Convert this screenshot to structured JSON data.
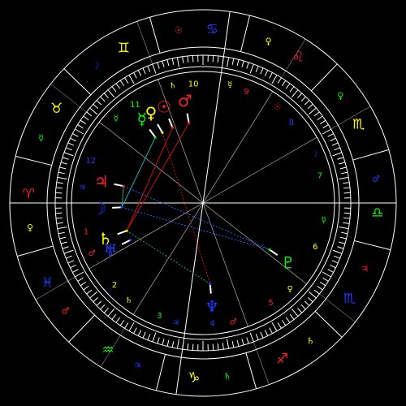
{
  "colors": {
    "background": "#000000",
    "ring_lines": "#ffffff",
    "house_lines": "#cccccc",
    "fire": "#ff2020",
    "earth": "#ffff00",
    "air": "#00ff00",
    "water": "#1a3cff",
    "aspect_red": "#cc1111",
    "aspect_blue": "#2266ff",
    "aspect_green": "#22aa66",
    "aspect_cyan": "#22aaaa"
  },
  "zodiac_signs": [
    {
      "glyph": "♏",
      "color": "#ffff00",
      "name": "virgo"
    },
    {
      "glyph": "♌",
      "color": "#ff2020",
      "name": "leo"
    },
    {
      "glyph": "♋",
      "color": "#1a3cff",
      "name": "cancer"
    },
    {
      "glyph": "♊",
      "color": "#ffff00",
      "name": "gemini"
    },
    {
      "glyph": "♉",
      "color": "#ffff00",
      "name": "taurus"
    },
    {
      "glyph": "♈",
      "color": "#ff2020",
      "name": "aries"
    },
    {
      "glyph": "♓",
      "color": "#1a3cff",
      "name": "pisces"
    },
    {
      "glyph": "♒",
      "color": "#00ff00",
      "name": "aquarius"
    },
    {
      "glyph": "♑",
      "color": "#ffff00",
      "name": "capricorn"
    },
    {
      "glyph": "♐",
      "color": "#ff2020",
      "name": "sagittarius"
    },
    {
      "glyph": "♏",
      "color": "#1a3cff",
      "name": "scorpio"
    },
    {
      "glyph": "♎",
      "color": "#00ff00",
      "name": "libra"
    }
  ],
  "sign_rulers": [
    {
      "glyph": "♀",
      "color": "#00ff00"
    },
    {
      "glyph": "♀",
      "color": "#ffff00"
    },
    {
      "glyph": "☉",
      "color": "#ff2020"
    },
    {
      "glyph": "☽",
      "color": "#1a3cff"
    },
    {
      "glyph": "☿",
      "color": "#00ff00"
    },
    {
      "glyph": "♀",
      "color": "#ffff00"
    },
    {
      "glyph": "♂",
      "color": "#ff2020"
    },
    {
      "glyph": "♃",
      "color": "#1a3cff"
    },
    {
      "glyph": "♄",
      "color": "#00ff00"
    },
    {
      "glyph": "♄",
      "color": "#ffff00"
    },
    {
      "glyph": "♃",
      "color": "#ff2020"
    },
    {
      "glyph": "♂",
      "color": "#1a3cff"
    }
  ],
  "house_numbers": [
    {
      "label": "1",
      "color": "#ff2020"
    },
    {
      "label": "2",
      "color": "#ffff00"
    },
    {
      "label": "3",
      "color": "#00ff00"
    },
    {
      "label": "4",
      "color": "#1a3cff"
    },
    {
      "label": "5",
      "color": "#ff2020"
    },
    {
      "label": "6",
      "color": "#ffff00"
    },
    {
      "label": "7",
      "color": "#00ff00"
    },
    {
      "label": "8",
      "color": "#1a3cff"
    },
    {
      "label": "9",
      "color": "#ff2020"
    },
    {
      "label": "10",
      "color": "#ffff00"
    },
    {
      "label": "11",
      "color": "#00ff00"
    },
    {
      "label": "12",
      "color": "#1a3cff"
    }
  ],
  "house_rulers": [
    {
      "glyph": "♂",
      "color": "#ff2020"
    },
    {
      "glyph": "♄",
      "color": "#ffff00"
    },
    {
      "glyph": "♃",
      "color": "#1a3cff"
    },
    {
      "glyph": "♂",
      "color": "#ff2020"
    },
    {
      "glyph": "♀",
      "color": "#ffff00"
    },
    {
      "glyph": "☿",
      "color": "#00ff00"
    },
    {
      "glyph": "☽",
      "color": "#1a3cff"
    },
    {
      "glyph": "☉",
      "color": "#ff2020"
    },
    {
      "glyph": "☿",
      "color": "#ffff00"
    },
    {
      "glyph": "♄",
      "color": "#ffff00"
    },
    {
      "glyph": "☿",
      "color": "#00ff00"
    },
    {
      "glyph": "♃",
      "color": "#1a3cff"
    }
  ],
  "planets": [
    {
      "name": "sun",
      "glyph": "☉",
      "color": "#ff2020"
    },
    {
      "name": "mars",
      "glyph": "♂",
      "color": "#ff2020"
    },
    {
      "name": "mercury",
      "glyph": "☿",
      "color": "#00ff00"
    },
    {
      "name": "venus",
      "glyph": "♀",
      "color": "#ffff00"
    },
    {
      "name": "jupiter",
      "glyph": "♃",
      "color": "#ff2020"
    },
    {
      "name": "moon",
      "glyph": "☽",
      "color": "#1a3cff"
    },
    {
      "name": "saturn",
      "glyph": "♄",
      "color": "#ffff00"
    },
    {
      "name": "uranus",
      "glyph": "♅",
      "color": "#1a3cff"
    },
    {
      "name": "neptune",
      "glyph": "♆",
      "color": "#1a3cff"
    },
    {
      "name": "pluto",
      "glyph": "♇",
      "color": "#00ff00"
    }
  ]
}
